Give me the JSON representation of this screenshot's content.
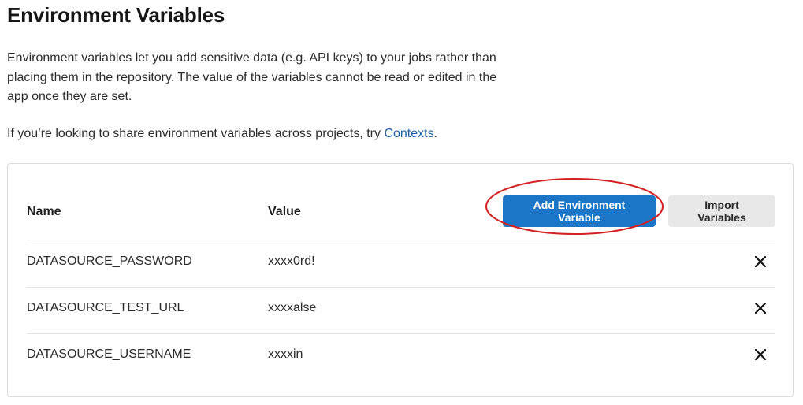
{
  "page": {
    "title": "Environment Variables",
    "intro": "Environment variables let you add sensitive data (e.g. API keys) to your jobs rather than placing them in the repository. The value of the variables cannot be read or edited in the app once they are set.",
    "contexts_prefix": "If you’re looking to share environment variables across projects, try ",
    "contexts_link": "Contexts",
    "contexts_suffix": "."
  },
  "table": {
    "headers": {
      "name": "Name",
      "value": "Value"
    },
    "add_button": "Add Environment Variable",
    "import_button": "Import Variables",
    "rows": [
      {
        "name": "DATASOURCE_PASSWORD",
        "value": "xxxx0rd!",
        "delete_icon": "close-icon"
      },
      {
        "name": "DATASOURCE_TEST_URL",
        "value": "xxxxalse",
        "delete_icon": "close-icon"
      },
      {
        "name": "DATASOURCE_USERNAME",
        "value": "xxxxin",
        "delete_icon": "close-icon"
      }
    ]
  },
  "colors": {
    "accent": "#1b76c8",
    "link": "#1b5fa8",
    "annotation": "#d42020",
    "secondary_button": "#e8e8e8"
  }
}
